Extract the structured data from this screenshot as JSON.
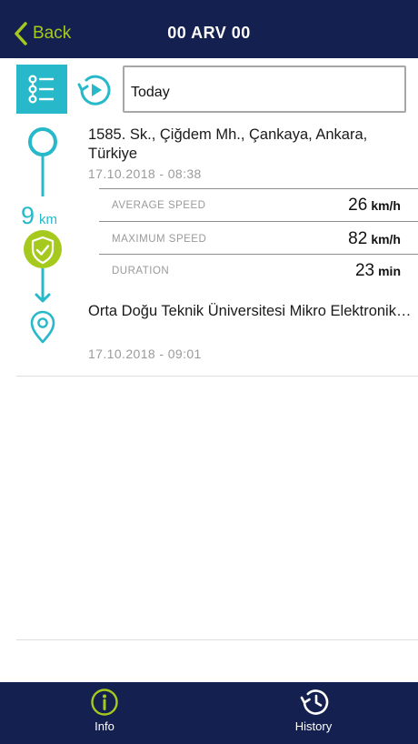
{
  "nav": {
    "back_label": "Back",
    "title": "00 ARV 00",
    "back_icon": "chevron-left-icon",
    "accent_color": "#a6c91e",
    "bar_color": "#14204f"
  },
  "toolbar": {
    "list_icon": "list-view-icon",
    "replay_icon": "replay-icon",
    "date_value": "Today",
    "button_color": "#27b9c9"
  },
  "trip": {
    "start": {
      "address": "1585. Sk., Çiğdem Mh., Çankaya, Ankara, Türkiye",
      "datetime": "17.10.2018 - 08:38"
    },
    "distance_value": "9",
    "distance_unit": "km",
    "stats": [
      {
        "label": "AVERAGE SPEED",
        "value": "26",
        "unit": "km/h"
      },
      {
        "label": "MAXIMUM SPEED",
        "value": "82",
        "unit": "km/h"
      },
      {
        "label": "DURATION",
        "value": "23",
        "unit": "min"
      }
    ],
    "end": {
      "address": "Orta Doğu Teknik Üniversitesi Mikro Elektronik Mekanik A, Mustafa Kemal Mh., Ç...",
      "datetime": "17.10.2018 - 09:01"
    },
    "badge_icon": "shield-check-icon",
    "badge_color": "#a6c91e"
  },
  "tabs": [
    {
      "label": "Info",
      "icon": "info-icon"
    },
    {
      "label": "History",
      "icon": "history-icon"
    }
  ]
}
